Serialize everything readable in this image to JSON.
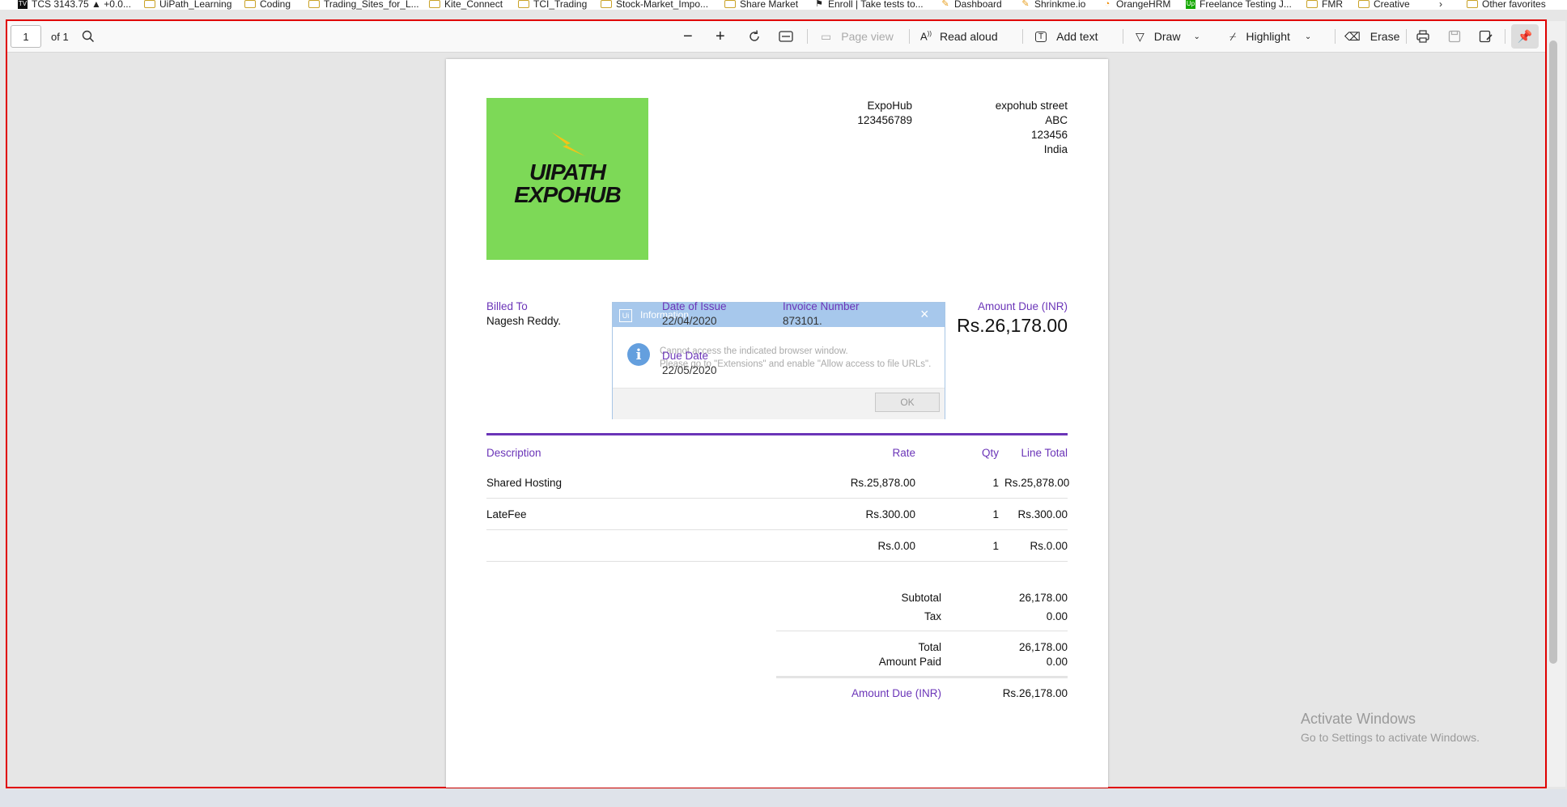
{
  "bookmarks": [
    {
      "label": "TCS 3143.75 ▲ +0.0...",
      "icon": "tradingview-icon"
    },
    {
      "label": "UiPath_Learning",
      "icon": "folder-icon"
    },
    {
      "label": "Coding",
      "icon": "folder-icon"
    },
    {
      "label": "Trading_Sites_for_L...",
      "icon": "folder-icon"
    },
    {
      "label": "Kite_Connect",
      "icon": "folder-icon"
    },
    {
      "label": "TCI_Trading",
      "icon": "folder-icon"
    },
    {
      "label": "Stock-Market_Impo...",
      "icon": "folder-icon"
    },
    {
      "label": "Share Market",
      "icon": "folder-icon"
    },
    {
      "label": "Enroll | Take tests to...",
      "icon": "site-icon"
    },
    {
      "label": "Dashboard",
      "icon": "site-icon"
    },
    {
      "label": "Shrinkme.io",
      "icon": "site-icon"
    },
    {
      "label": "OrangeHRM",
      "icon": "site-icon"
    },
    {
      "label": "Freelance Testing J...",
      "icon": "upwork-icon"
    },
    {
      "label": "FMR",
      "icon": "folder-icon"
    },
    {
      "label": "Creative",
      "icon": "folder-icon"
    },
    {
      "label": "Other favorites",
      "icon": "folder-icon"
    }
  ],
  "toolbar": {
    "page_number": "1",
    "page_count": "of 1",
    "page_view": "Page view",
    "read_aloud": "Read aloud",
    "add_text": "Add text",
    "draw": "Draw",
    "highlight": "Highlight",
    "erase": "Erase"
  },
  "invoice": {
    "logo_line1": "UIPATH",
    "logo_line2": "EXPOHUB",
    "company_name": "ExpoHub",
    "company_phone": "123456789",
    "address": [
      "expohub street",
      "ABC",
      "123456",
      "India"
    ],
    "billed_to_label": "Billed To",
    "billed_to": "Nagesh Reddy.",
    "date_of_issue_label": "Date of Issue",
    "date_of_issue": "22/04/2020",
    "invoice_number_label": "Invoice Number",
    "invoice_number": "873101.",
    "due_date_label": "Due Date",
    "due_date": "22/05/2020",
    "amount_due_label": "Amount Due (INR)",
    "amount_due": "Rs.26,178.00",
    "table_headers": {
      "description": "Description",
      "rate": "Rate",
      "qty": "Qty",
      "line_total": "Line Total"
    },
    "items": [
      {
        "description": "Shared Hosting",
        "rate": "Rs.25,878.00",
        "qty": "1",
        "line_total": "Rs.25,878.00"
      },
      {
        "description": "LateFee",
        "rate": "Rs.300.00",
        "qty": "1",
        "line_total": "Rs.300.00"
      },
      {
        "description": "",
        "rate": "Rs.0.00",
        "qty": "1",
        "line_total": "Rs.0.00"
      }
    ],
    "subtotal_label": "Subtotal",
    "subtotal": "26,178.00",
    "tax_label": "Tax",
    "tax": "0.00",
    "total_label": "Total",
    "total": "26,178.00",
    "amount_paid_label": "Amount Paid",
    "amount_paid": "0.00",
    "amount_due_footer_label": "Amount Due (INR)",
    "amount_due_footer": "Rs.26,178.00"
  },
  "dialog": {
    "title": "Information",
    "line1": "Cannot access the indicated browser window.",
    "line2": "Please go to \"Extensions\" and enable \"Allow access to file URLs\".",
    "ok": "OK"
  },
  "watermark": {
    "line1": "Activate Windows",
    "line2": "Go to Settings to activate Windows."
  },
  "colors": {
    "accent": "#6b35b8",
    "logo_bg": "#7dd957",
    "frame": "#e00000",
    "dialog_header": "#a7c8ec"
  }
}
